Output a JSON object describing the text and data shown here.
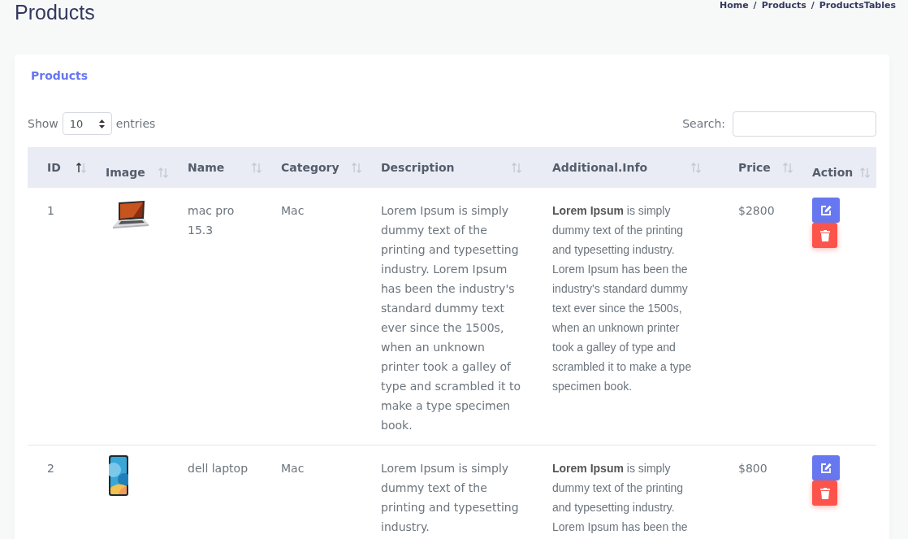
{
  "page_title": "Products",
  "breadcrumb": {
    "separator": "/",
    "items": [
      "Home",
      "Products",
      "ProductsTables"
    ]
  },
  "card_title": "Products",
  "length_control": {
    "label_before": "Show",
    "value": "10",
    "label_after": "entries"
  },
  "search": {
    "label": "Search:"
  },
  "table": {
    "columns": [
      {
        "label": "ID",
        "sorted_ascending": true
      },
      {
        "label": "Image",
        "sorted_ascending": false
      },
      {
        "label": "Name",
        "sorted_ascending": false
      },
      {
        "label": "Category",
        "sorted_ascending": false
      },
      {
        "label": "Description",
        "sorted_ascending": false
      },
      {
        "label": "Additional.Info",
        "sorted_ascending": false
      },
      {
        "label": "Price",
        "sorted_ascending": false
      },
      {
        "label": "Action",
        "sorted_ascending": false
      }
    ],
    "rows": [
      {
        "id": "1",
        "image": {
          "kind": "laptop"
        },
        "name": "mac pro 15.3",
        "category": "Mac",
        "description": "Lorem Ipsum is simply dummy text of the printing and typesetting industry. Lorem Ipsum has been the industry's standard dummy text ever since the 1500s, when an unknown printer took a galley of type and scrambled it to make a type specimen book.",
        "additional_info": "**Lorem Ipsum** is simply dummy text of the printing and typesetting industry. Lorem Ipsum has been the industry's standard dummy text ever since the 1500s, when an unknown printer took a galley of type and scrambled it to make a type specimen book.",
        "price": "$2800"
      },
      {
        "id": "2",
        "image": {
          "kind": "phone"
        },
        "name": "dell laptop",
        "category": "Mac",
        "description": "Lorem Ipsum is simply dummy text of the printing and typesetting industry.",
        "additional_info": "**Lorem Ipsum** is simply dummy text of the printing and typesetting industry. Lorem Ipsum has been the",
        "price": "$800"
      }
    ]
  }
}
